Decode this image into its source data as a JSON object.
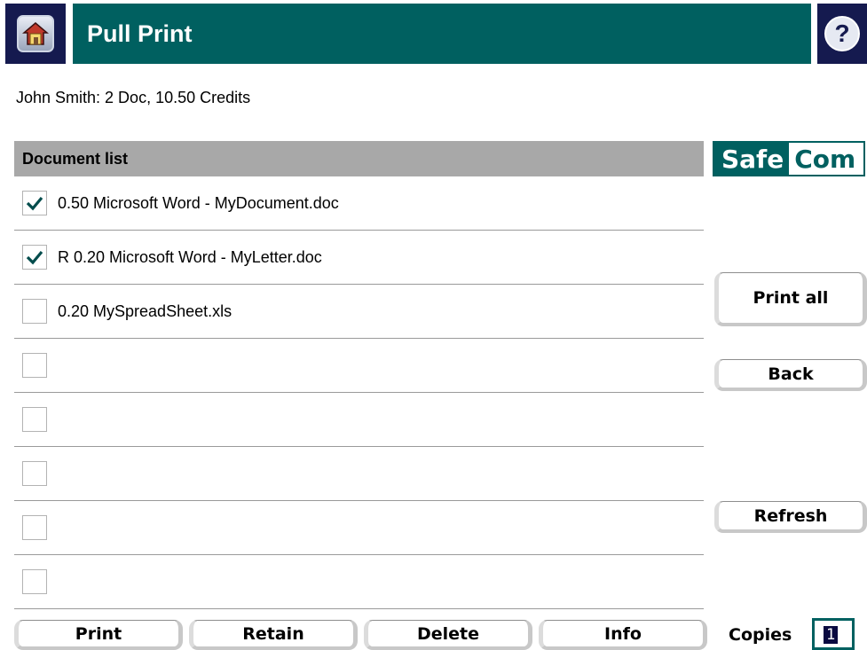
{
  "header": {
    "title": "Pull Print",
    "home_icon": "home-icon",
    "help_icon": "help-icon",
    "help_glyph": "?"
  },
  "user_info": "John Smith: 2 Doc, 10.50 Credits",
  "document_list": {
    "header": "Document list",
    "rows": [
      {
        "checked": true,
        "label": "0.50 Microsoft Word - MyDocument.doc"
      },
      {
        "checked": true,
        "label": "R 0.20 Microsoft Word - MyLetter.doc"
      },
      {
        "checked": false,
        "label": "0.20 MySpreadSheet.xls"
      },
      {
        "checked": false,
        "label": ""
      },
      {
        "checked": false,
        "label": ""
      },
      {
        "checked": false,
        "label": ""
      },
      {
        "checked": false,
        "label": ""
      },
      {
        "checked": false,
        "label": ""
      }
    ]
  },
  "logo": {
    "part1": "Safe",
    "part2": "Com"
  },
  "side_buttons": {
    "print_all": "Print all",
    "back": "Back",
    "refresh": "Refresh"
  },
  "bottom_buttons": {
    "print": "Print",
    "retain": "Retain",
    "delete": "Delete",
    "info": "Info"
  },
  "copies": {
    "label": "Copies",
    "value": "1"
  },
  "colors": {
    "accent": "#006060",
    "header_dark": "#151a4f",
    "list_header_bg": "#a8a8a8"
  }
}
